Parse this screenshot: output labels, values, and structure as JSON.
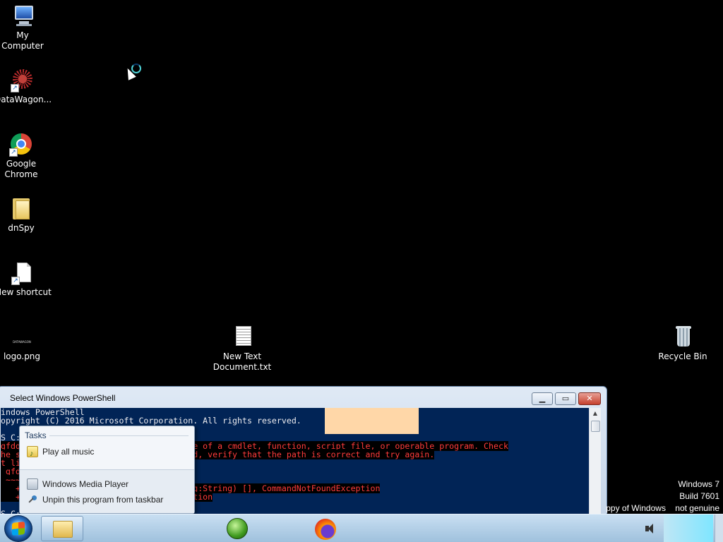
{
  "desktop": {
    "icons": [
      {
        "label": "My Computer"
      },
      {
        "label": "DataWagon..."
      },
      {
        "label": "Google Chrome"
      },
      {
        "label": "dnSpy"
      },
      {
        "label": "New shortcut"
      },
      {
        "label": "logo.png",
        "logo_text": "DATAWAGON"
      },
      {
        "label": "New Text Document.txt"
      },
      {
        "label": "Recycle Bin"
      }
    ]
  },
  "powershell": {
    "title": "Select Windows PowerShell",
    "lines": [
      "indows PowerShell",
      "opyright (C) 2016 Microsoft Corporation. All rights reserved.",
      "",
      "S C:",
      "gfdg                         as the name of a cmdlet, function, script file, or operable program. Check",
      "he s                         as included, verify that the path is correct and try again.",
      "t li",
      " gfd",
      " ~~~",
      "   +                         ound: (gfdg:String) [], CommandNotFoundException",
      "   +                         FoundException",
      "",
      "S C:"
    ],
    "error_line_indexes": [
      4,
      5,
      6,
      7,
      8,
      9,
      10
    ]
  },
  "jumplist": {
    "header": "Tasks",
    "task_item": "Play all music",
    "program_item": "Windows Media Player",
    "unpin_item": "Unpin this program from taskbar"
  },
  "watermark": {
    "line1": "Windows 7",
    "line2": "Build 7601",
    "line3": "ppy of Windows    not genuine"
  },
  "icons": {
    "start": "windows-start-orb",
    "explorer": "windows-explorer-icon",
    "media": "windows-media-player-icon",
    "firefox": "firefox-icon",
    "volume": "speaker-icon"
  },
  "colors": {
    "console_bg": "#012456",
    "console_fg": "#eeedf0",
    "error_fg": "#ff3b3b",
    "selection": "#ffd7a8",
    "desktop_bg": "#000000"
  }
}
